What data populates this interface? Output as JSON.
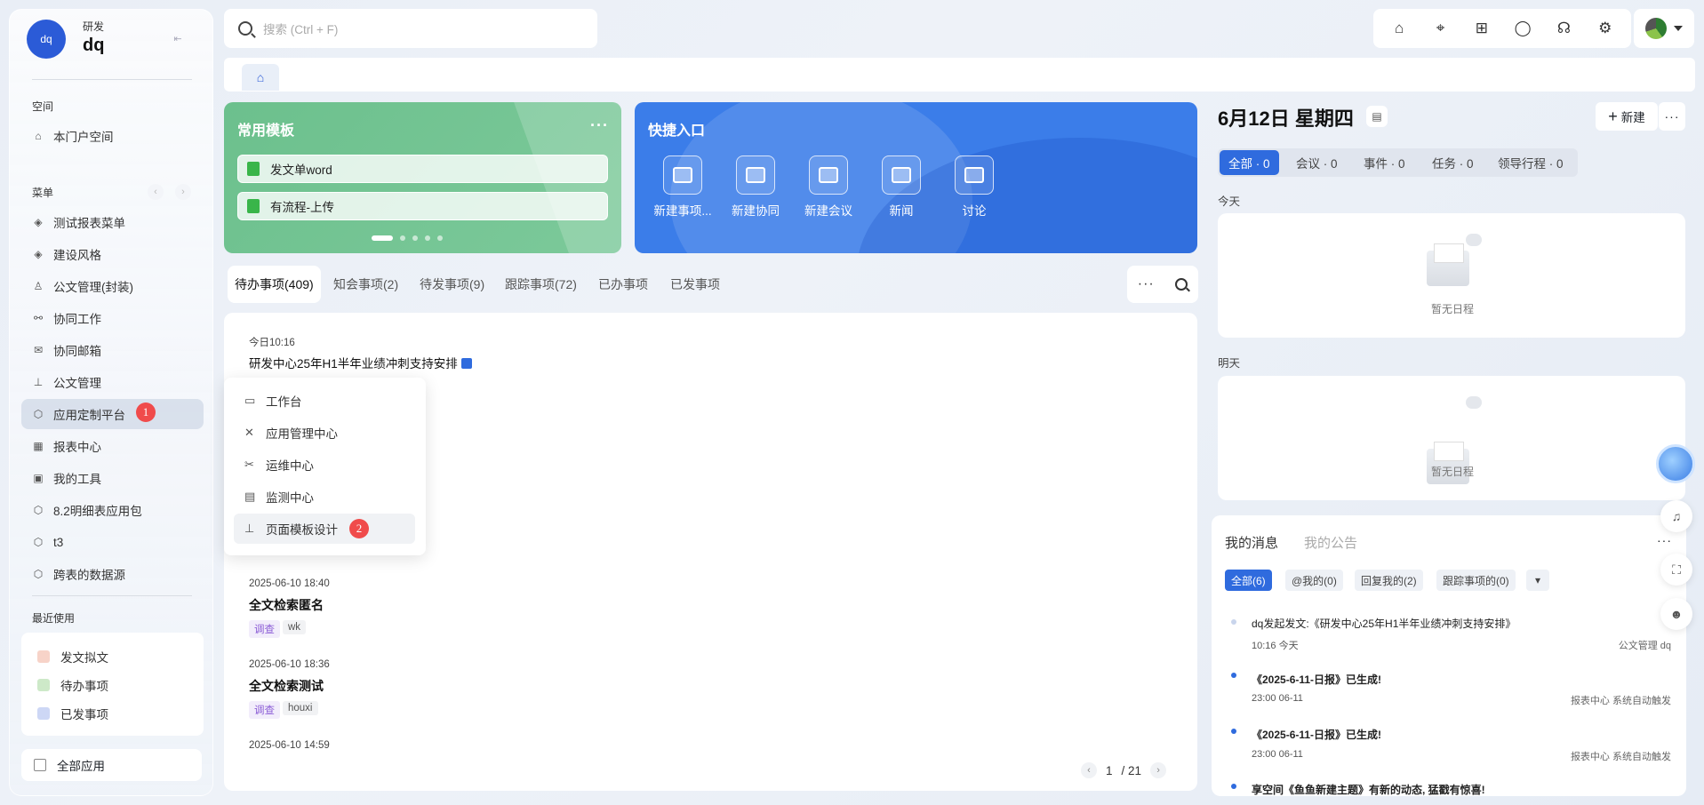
{
  "user": {
    "avatar_text": "dq",
    "dept": "研发",
    "name": "dq"
  },
  "sidebar": {
    "space_label": "空间",
    "space_item": "本门户空间",
    "menu_label": "菜单",
    "items": [
      {
        "label": "测试报表菜单",
        "icon": "layers-icon"
      },
      {
        "label": "建设风格",
        "icon": "layers-icon"
      },
      {
        "label": "公文管理(封装)",
        "icon": "user-icon"
      },
      {
        "label": "协同工作",
        "icon": "flow-icon"
      },
      {
        "label": "协同邮箱",
        "icon": "mail-icon"
      },
      {
        "label": "公文管理",
        "icon": "stamp-icon"
      },
      {
        "label": "应用定制平台",
        "icon": "cube-icon"
      },
      {
        "label": "报表中心",
        "icon": "report-icon"
      },
      {
        "label": "我的工具",
        "icon": "toolbox-icon"
      },
      {
        "label": "8.2明细表应用包",
        "icon": "cube-icon"
      },
      {
        "label": "t3",
        "icon": "cube-icon"
      },
      {
        "label": "跨表的数据源",
        "icon": "cube-icon"
      }
    ],
    "badge_1": "1",
    "recent_label": "最近使用",
    "recent": [
      {
        "label": "发文拟文",
        "color": "#f7d3c8"
      },
      {
        "label": "待办事项",
        "color": "#cde9c8"
      },
      {
        "label": "已发事项",
        "color": "#cdd7f5"
      }
    ],
    "all_apps": "全部应用"
  },
  "search": {
    "placeholder": "搜索 (Ctrl + F)"
  },
  "templates": {
    "title": "常用模板",
    "items": [
      "发文单word",
      "有流程-上传"
    ]
  },
  "quick": {
    "title": "快捷入口",
    "items": [
      "新建事项...",
      "新建协同",
      "新建会议",
      "新闻",
      "讨论"
    ]
  },
  "todo_tabs": [
    "待办事项(409)",
    "知会事项(2)",
    "待发事项(9)",
    "跟踪事项(72)",
    "已办事项",
    "已发事项"
  ],
  "todo_list": [
    {
      "date": "今日10:16",
      "title": "研发中心25年H1半年业绩冲刺支持安排"
    },
    {
      "date": "2025-06-10 18:40",
      "title": "全文检索匿名",
      "tags": [
        "调查",
        "wk"
      ]
    },
    {
      "date": "2025-06-10 18:36",
      "title": "全文检索测试",
      "tags": [
        "调查",
        "houxi"
      ]
    },
    {
      "date": "2025-06-10 14:59"
    }
  ],
  "popup": {
    "items": [
      "工作台",
      "应用管理中心",
      "运维中心",
      "监测中心",
      "页面模板设计"
    ],
    "badge_2": "2"
  },
  "pager": {
    "current": "1",
    "total": "/ 21"
  },
  "calendar": {
    "date": "6月12日 星期四",
    "new_label": "新建",
    "filters": [
      "全部 · 0",
      "会议 · 0",
      "事件 · 0",
      "任务 · 0",
      "领导行程 · 0"
    ],
    "today": "今天",
    "tomorrow": "明天",
    "empty": "暂无日程"
  },
  "messages": {
    "tabs": [
      "我的消息",
      "我的公告"
    ],
    "chips": [
      "全部(6)",
      "@我的(0)",
      "回复我的(2)",
      "跟踪事项的(0)"
    ],
    "items": [
      {
        "title": "dq发起发文:《研发中心25年H1半年业绩冲刺支持安排》",
        "time": "10:16 今天",
        "source": "公文管理 dq"
      },
      {
        "title": "《2025-6-11-日报》已生成!",
        "time": "23:00 06-11",
        "source": "报表中心 系统自动触发"
      },
      {
        "title": "《2025-6-11-日报》已生成!",
        "time": "23:00 06-11",
        "source": "报表中心 系统自动触发"
      },
      {
        "title": "享空间《鱼鱼新建主题》有新的动态, 猛戳有惊喜!"
      }
    ]
  },
  "colors": {
    "accent": "#2f6bde",
    "template_green": "#6cc08d",
    "quick_blue": "#3b7de9",
    "badge_red": "#f04b4b"
  }
}
